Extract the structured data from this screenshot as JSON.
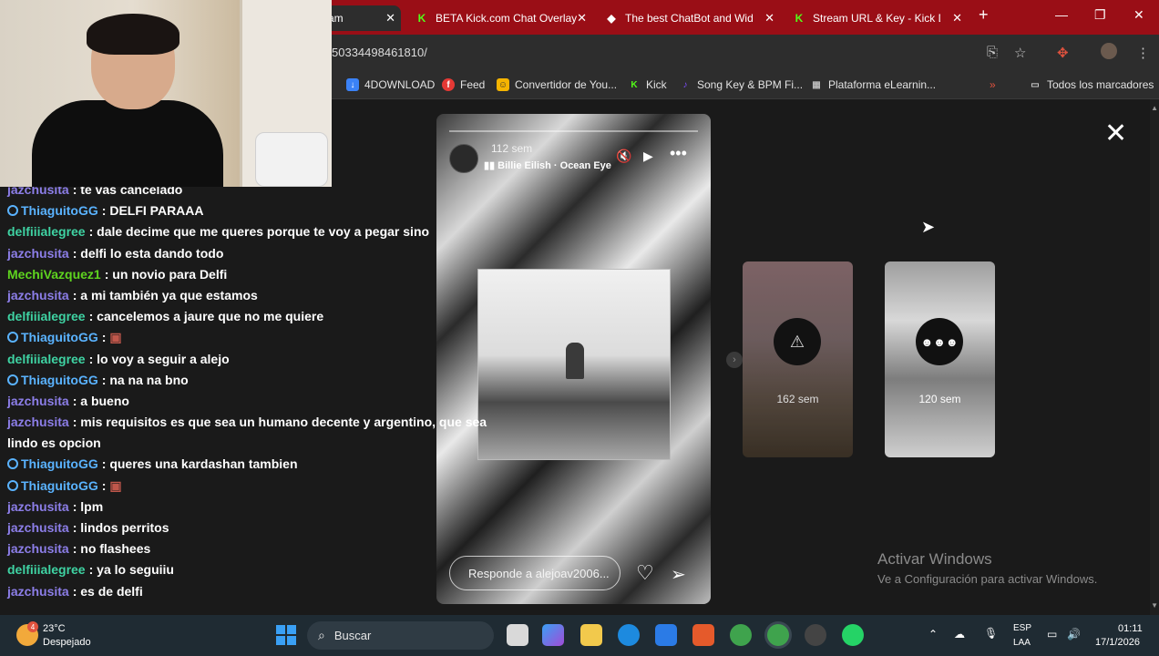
{
  "tabs": [
    {
      "title": "am",
      "close": "✕",
      "favicon": "kick-icon"
    },
    {
      "title": "BETA Kick.com Chat Overlay",
      "close": "✕",
      "favicon": "kick-icon"
    },
    {
      "title": "The best ChatBot and Widg",
      "close": "✕",
      "favicon": "diamond-icon"
    },
    {
      "title": "Stream URL & Key - Kick Da",
      "close": "✕",
      "favicon": "kick-icon"
    }
  ],
  "new_tab": "+",
  "window_controls": {
    "minimize": "—",
    "restore": "❐",
    "close": "✕"
  },
  "url": "50334498461810/",
  "bookmarks": [
    {
      "label": "4DOWNLOAD",
      "color": "#3b82f6"
    },
    {
      "label": "Feed",
      "color": "#e53935"
    },
    {
      "label": "Convertidor de You...",
      "color": "#f5b400"
    },
    {
      "label": "Kick",
      "color": "#53fc18"
    },
    {
      "label": "Song Key & BPM Fi...",
      "color": "#7c4dff"
    },
    {
      "label": "Plataforma eLearnin...",
      "color": "#9e9e9e"
    }
  ],
  "bookmarks_more": "»",
  "all_bookmarks": "Todos los marcadores",
  "story": {
    "time": "112 sem",
    "song": "Billie Eilish · Ocean Eye",
    "reply_placeholder": "Responde a alejoav2006...",
    "progress": 1.0
  },
  "thumbs": [
    {
      "label": "162 sem"
    },
    {
      "label": "120 sem"
    }
  ],
  "close_symbol": "✕",
  "activate": {
    "title": "Activar Windows",
    "subtitle": "Ve a Configuración para activar Windows."
  },
  "chat": [
    {
      "user": "jazchusita",
      "cls": "u-jaz",
      "badge": false,
      "text": "te vas cancelado"
    },
    {
      "user": "ThiaguitoGG",
      "cls": "u-thi",
      "badge": true,
      "text": "DELFI PARAAA"
    },
    {
      "user": "delfiiialegree",
      "cls": "u-del",
      "badge": false,
      "text": "dale decime que me queres porque te voy a pegar sino"
    },
    {
      "user": "jazchusita",
      "cls": "u-jaz",
      "badge": false,
      "text": "delfi lo esta dando todo"
    },
    {
      "user": "MechiVazquez1",
      "cls": "u-mec",
      "badge": false,
      "text": "un novio para Delfi"
    },
    {
      "user": "jazchusita",
      "cls": "u-jaz",
      "badge": false,
      "text": "a mi también ya que estamos"
    },
    {
      "user": "delfiiialegree",
      "cls": "u-del",
      "badge": false,
      "text": "cancelemos a jaure que no me quiere"
    },
    {
      "user": "ThiaguitoGG",
      "cls": "u-thi",
      "badge": true,
      "text": ""
    },
    {
      "user": "delfiiialegree",
      "cls": "u-del",
      "badge": false,
      "text": "lo voy a seguir a alejo"
    },
    {
      "user": "ThiaguitoGG",
      "cls": "u-thi",
      "badge": true,
      "text": "na na na bno"
    },
    {
      "user": "jazchusita",
      "cls": "u-jaz",
      "badge": false,
      "text": "a bueno"
    },
    {
      "user": "jazchusita",
      "cls": "u-jaz",
      "badge": false,
      "text": "mis requisitos es que sea un humano decente y argentino, que sea"
    },
    {
      "user": "",
      "cls": "u-jaz",
      "badge": false,
      "text": "lindo es opcion"
    },
    {
      "user": "ThiaguitoGG",
      "cls": "u-thi",
      "badge": true,
      "text": "queres una kardashan tambien"
    },
    {
      "user": "ThiaguitoGG",
      "cls": "u-thi",
      "badge": true,
      "text": ""
    },
    {
      "user": "jazchusita",
      "cls": "u-jaz",
      "badge": false,
      "text": "lpm"
    },
    {
      "user": "jazchusita",
      "cls": "u-jaz",
      "badge": false,
      "text": "lindos perritos"
    },
    {
      "user": "jazchusita",
      "cls": "u-jaz",
      "badge": false,
      "text": "no flashees"
    },
    {
      "user": "delfiiialegree",
      "cls": "u-del",
      "badge": false,
      "text": "ya lo seguiiu"
    },
    {
      "user": "jazchusita",
      "cls": "u-jaz",
      "badge": false,
      "text": "es de delfi"
    }
  ],
  "taskbar": {
    "weather_badge": "4",
    "temp": "23°C",
    "weather": "Despejado",
    "search": "Buscar",
    "lang": "ESP",
    "lang2": "LAA",
    "time": "01:11",
    "date": "17/1/2026"
  }
}
